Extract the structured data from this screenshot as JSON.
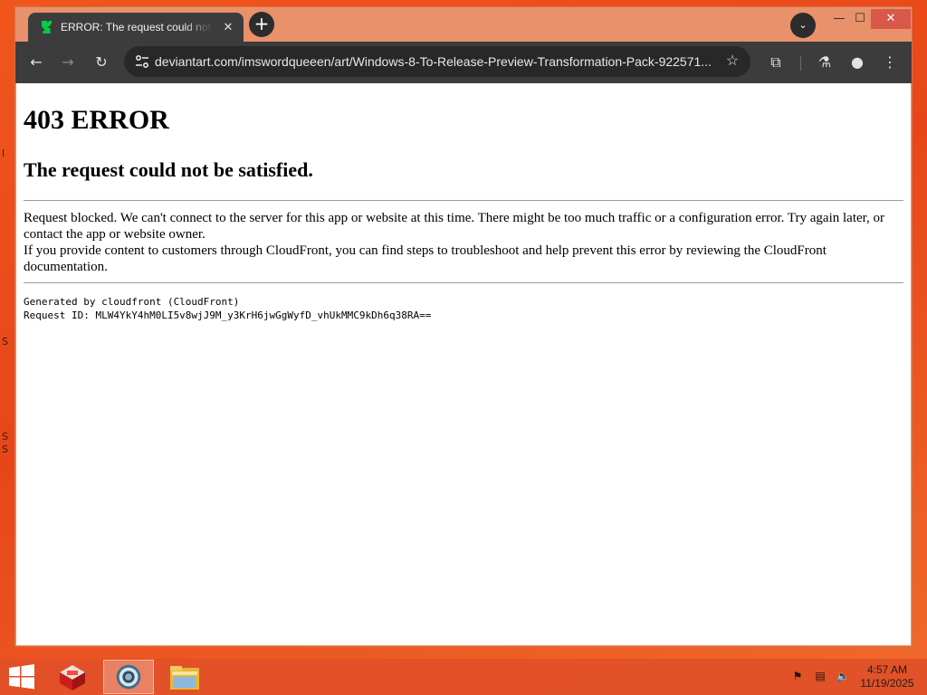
{
  "tab": {
    "title": "ERROR: The request could not be satisfied",
    "close_glyph": "✕",
    "new_tab_glyph": "+",
    "search_glyph": "⌄"
  },
  "window_controls": {
    "minimize": "—",
    "maximize": "☐",
    "close": "✕"
  },
  "toolbar": {
    "back_glyph": "←",
    "forward_glyph": "→",
    "reload_glyph": "↻",
    "url": "deviantart.com/imswordqueeen/art/Windows-8-To-Release-Preview-Transformation-Pack-922571...",
    "star_glyph": "☆",
    "extensions_glyph": "⧉",
    "labs_glyph": "⚗",
    "profile_glyph": "●",
    "menu_glyph": "⋮"
  },
  "page": {
    "heading": "403 ERROR",
    "subheading": "The request could not be satisfied.",
    "paragraph1": "Request blocked. We can't connect to the server for this app or website at this time. There might be too much traffic or a configuration error. Try again later, or contact the app or website owner.",
    "paragraph2": "If you provide content to customers through CloudFront, you can find steps to troubleshoot and help prevent this error by reviewing the CloudFront documentation.",
    "generated_by": "Generated by cloudfront (CloudFront)",
    "request_id": "Request ID: MLW4YkY4hM0LI5v8wjJ9M_y3KrH6jwGgWyfD_vhUkMMC9kDh6q38RA=="
  },
  "desktop": {
    "edge_glyphs": [
      "l",
      "S",
      "S",
      "S"
    ]
  },
  "taskbar": {
    "time": "4:57 AM",
    "date": "11/19/2025"
  },
  "colors": {
    "desktop": "#e8461a",
    "titlebar": "#e8916a",
    "tab": "#3c3c3c",
    "close_button": "#d9584a",
    "favicon": "#05cc47"
  }
}
